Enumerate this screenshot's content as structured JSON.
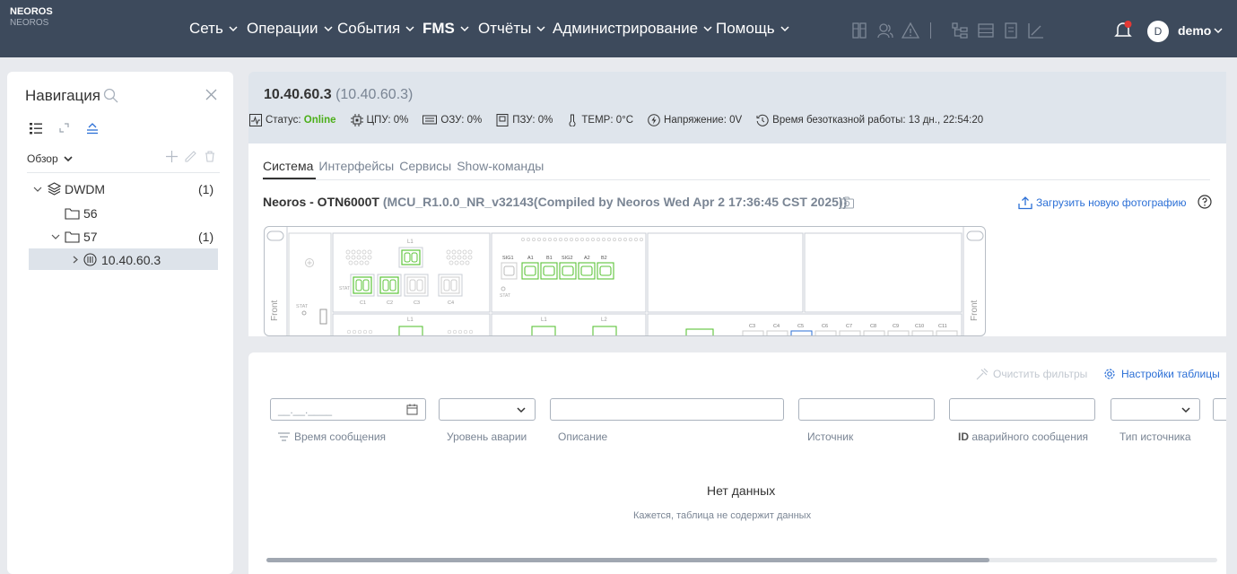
{
  "brand": {
    "title": "NEOROS",
    "subtitle": "NEOROS"
  },
  "menu": [
    {
      "label": "Сеть"
    },
    {
      "label": "Операции"
    },
    {
      "label": "События"
    },
    {
      "label": "FMS"
    },
    {
      "label": "Отчёты"
    },
    {
      "label": "Администрирование"
    },
    {
      "label": "Помощь"
    }
  ],
  "user": {
    "avatar_letter": "D",
    "name": "demo"
  },
  "nav": {
    "title": "Навигация",
    "overview_label": "Обзор",
    "tree": [
      {
        "label": "DWDM",
        "count": "(1)"
      },
      {
        "label": "56",
        "count": ""
      },
      {
        "label": "57",
        "count": "(1)"
      },
      {
        "label": "10.40.60.3",
        "count": ""
      }
    ]
  },
  "device": {
    "title": "10.40.60.3",
    "ip": "(10.40.60.3)",
    "status_label": "Статус:",
    "status_value": "Online",
    "status_color": "#4caf1a",
    "cpu": "ЦПУ: 0%",
    "ram": "ОЗУ: 0%",
    "rom": "ПЗУ: 0%",
    "temp": "TEMP: 0°C",
    "voltage": "Напряжение: 0V",
    "uptime": "Время безотказной работы: 13 дн., 22:54:20",
    "tabs": [
      "Система",
      "Интерфейсы",
      "Сервисы",
      "Show-команды"
    ],
    "model": "Neoros - OTN6000T",
    "firmware": "(MCU_R1.0.0_NR_v32143(Compiled by Neoros Wed Apr 2 17:36:45 CST 2025))",
    "upload_label": "Загрузить новую фотографию"
  },
  "chassis": {
    "front_left": "Front",
    "front_right": "Front",
    "stat": "STAT",
    "card1": {
      "l1": "L1",
      "ports": [
        "C1",
        "C2",
        "C3",
        "C4"
      ]
    },
    "card2": {
      "ports": [
        "SIG1",
        "A1",
        "B1",
        "SIG2",
        "A2",
        "B2"
      ],
      "stat": "STAT"
    },
    "card3": {
      "l1": "L1"
    },
    "card4": {
      "l1": "L1",
      "l2": "L2"
    },
    "card5": {
      "ports": [
        "C3",
        "C4",
        "C5",
        "C6",
        "C7",
        "C8",
        "C9",
        "C10",
        "C11"
      ]
    },
    "accent_green": "#5cc43a"
  },
  "table": {
    "clear_filters": "Очистить фильтры",
    "settings": "Настройки таблицы",
    "date_placeholder": "__.__.____",
    "columns": [
      "Время сообщения",
      "Уровень аварии",
      "Описание",
      "Источник",
      "ID аварийного сообщения",
      "Тип источника"
    ],
    "empty_title": "Нет данных",
    "empty_subtitle": "Кажется, таблица не содержит данных"
  },
  "colors": {
    "topbar": "#3d4a5c",
    "accent_blue": "#2b6fd6",
    "alert_red": "#e53935"
  }
}
